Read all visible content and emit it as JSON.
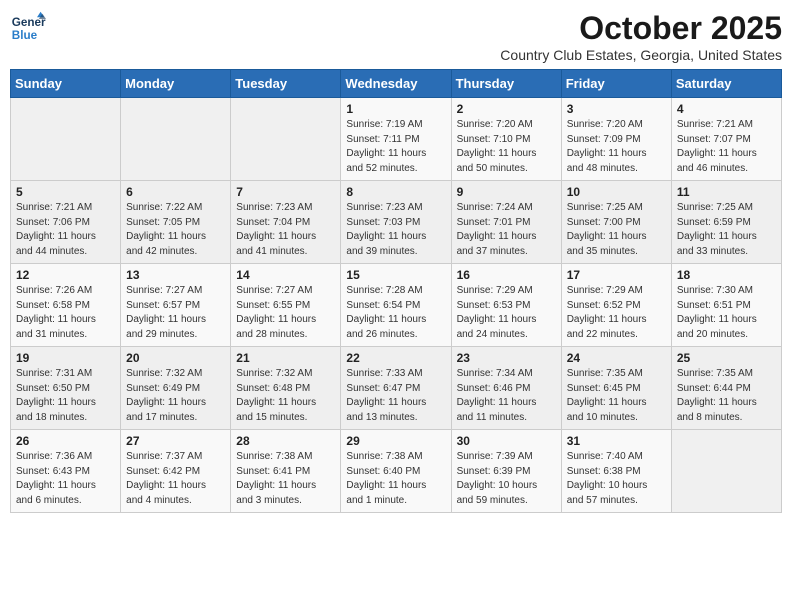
{
  "header": {
    "logo_line1": "General",
    "logo_line2": "Blue",
    "month": "October 2025",
    "location": "Country Club Estates, Georgia, United States"
  },
  "weekdays": [
    "Sunday",
    "Monday",
    "Tuesday",
    "Wednesday",
    "Thursday",
    "Friday",
    "Saturday"
  ],
  "weeks": [
    [
      {
        "day": "",
        "info": ""
      },
      {
        "day": "",
        "info": ""
      },
      {
        "day": "",
        "info": ""
      },
      {
        "day": "1",
        "info": "Sunrise: 7:19 AM\nSunset: 7:11 PM\nDaylight: 11 hours\nand 52 minutes."
      },
      {
        "day": "2",
        "info": "Sunrise: 7:20 AM\nSunset: 7:10 PM\nDaylight: 11 hours\nand 50 minutes."
      },
      {
        "day": "3",
        "info": "Sunrise: 7:20 AM\nSunset: 7:09 PM\nDaylight: 11 hours\nand 48 minutes."
      },
      {
        "day": "4",
        "info": "Sunrise: 7:21 AM\nSunset: 7:07 PM\nDaylight: 11 hours\nand 46 minutes."
      }
    ],
    [
      {
        "day": "5",
        "info": "Sunrise: 7:21 AM\nSunset: 7:06 PM\nDaylight: 11 hours\nand 44 minutes."
      },
      {
        "day": "6",
        "info": "Sunrise: 7:22 AM\nSunset: 7:05 PM\nDaylight: 11 hours\nand 42 minutes."
      },
      {
        "day": "7",
        "info": "Sunrise: 7:23 AM\nSunset: 7:04 PM\nDaylight: 11 hours\nand 41 minutes."
      },
      {
        "day": "8",
        "info": "Sunrise: 7:23 AM\nSunset: 7:03 PM\nDaylight: 11 hours\nand 39 minutes."
      },
      {
        "day": "9",
        "info": "Sunrise: 7:24 AM\nSunset: 7:01 PM\nDaylight: 11 hours\nand 37 minutes."
      },
      {
        "day": "10",
        "info": "Sunrise: 7:25 AM\nSunset: 7:00 PM\nDaylight: 11 hours\nand 35 minutes."
      },
      {
        "day": "11",
        "info": "Sunrise: 7:25 AM\nSunset: 6:59 PM\nDaylight: 11 hours\nand 33 minutes."
      }
    ],
    [
      {
        "day": "12",
        "info": "Sunrise: 7:26 AM\nSunset: 6:58 PM\nDaylight: 11 hours\nand 31 minutes."
      },
      {
        "day": "13",
        "info": "Sunrise: 7:27 AM\nSunset: 6:57 PM\nDaylight: 11 hours\nand 29 minutes."
      },
      {
        "day": "14",
        "info": "Sunrise: 7:27 AM\nSunset: 6:55 PM\nDaylight: 11 hours\nand 28 minutes."
      },
      {
        "day": "15",
        "info": "Sunrise: 7:28 AM\nSunset: 6:54 PM\nDaylight: 11 hours\nand 26 minutes."
      },
      {
        "day": "16",
        "info": "Sunrise: 7:29 AM\nSunset: 6:53 PM\nDaylight: 11 hours\nand 24 minutes."
      },
      {
        "day": "17",
        "info": "Sunrise: 7:29 AM\nSunset: 6:52 PM\nDaylight: 11 hours\nand 22 minutes."
      },
      {
        "day": "18",
        "info": "Sunrise: 7:30 AM\nSunset: 6:51 PM\nDaylight: 11 hours\nand 20 minutes."
      }
    ],
    [
      {
        "day": "19",
        "info": "Sunrise: 7:31 AM\nSunset: 6:50 PM\nDaylight: 11 hours\nand 18 minutes."
      },
      {
        "day": "20",
        "info": "Sunrise: 7:32 AM\nSunset: 6:49 PM\nDaylight: 11 hours\nand 17 minutes."
      },
      {
        "day": "21",
        "info": "Sunrise: 7:32 AM\nSunset: 6:48 PM\nDaylight: 11 hours\nand 15 minutes."
      },
      {
        "day": "22",
        "info": "Sunrise: 7:33 AM\nSunset: 6:47 PM\nDaylight: 11 hours\nand 13 minutes."
      },
      {
        "day": "23",
        "info": "Sunrise: 7:34 AM\nSunset: 6:46 PM\nDaylight: 11 hours\nand 11 minutes."
      },
      {
        "day": "24",
        "info": "Sunrise: 7:35 AM\nSunset: 6:45 PM\nDaylight: 11 hours\nand 10 minutes."
      },
      {
        "day": "25",
        "info": "Sunrise: 7:35 AM\nSunset: 6:44 PM\nDaylight: 11 hours\nand 8 minutes."
      }
    ],
    [
      {
        "day": "26",
        "info": "Sunrise: 7:36 AM\nSunset: 6:43 PM\nDaylight: 11 hours\nand 6 minutes."
      },
      {
        "day": "27",
        "info": "Sunrise: 7:37 AM\nSunset: 6:42 PM\nDaylight: 11 hours\nand 4 minutes."
      },
      {
        "day": "28",
        "info": "Sunrise: 7:38 AM\nSunset: 6:41 PM\nDaylight: 11 hours\nand 3 minutes."
      },
      {
        "day": "29",
        "info": "Sunrise: 7:38 AM\nSunset: 6:40 PM\nDaylight: 11 hours\nand 1 minute."
      },
      {
        "day": "30",
        "info": "Sunrise: 7:39 AM\nSunset: 6:39 PM\nDaylight: 10 hours\nand 59 minutes."
      },
      {
        "day": "31",
        "info": "Sunrise: 7:40 AM\nSunset: 6:38 PM\nDaylight: 10 hours\nand 57 minutes."
      },
      {
        "day": "",
        "info": ""
      }
    ]
  ]
}
